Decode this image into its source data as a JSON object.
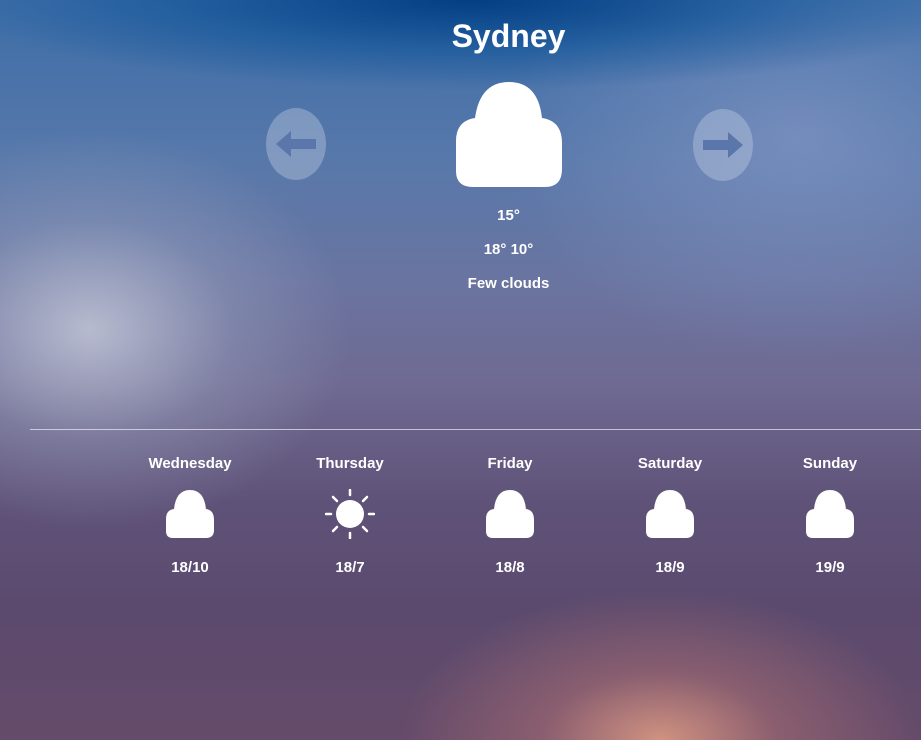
{
  "city": "Sydney",
  "current": {
    "icon": "cloud-icon",
    "temperature": "15°",
    "high_low": "18° 10°",
    "description": "Few clouds"
  },
  "navigation": {
    "prev_icon": "arrow-left-icon",
    "next_icon": "arrow-right-icon"
  },
  "forecast": [
    {
      "day": "Wednesday",
      "icon": "cloud-icon",
      "temps": "18/10"
    },
    {
      "day": "Thursday",
      "icon": "sun-icon",
      "temps": "18/7"
    },
    {
      "day": "Friday",
      "icon": "cloud-icon",
      "temps": "18/8"
    },
    {
      "day": "Saturday",
      "icon": "cloud-icon",
      "temps": "18/9"
    },
    {
      "day": "Sunday",
      "icon": "cloud-icon",
      "temps": "19/9"
    }
  ],
  "colors": {
    "text": "#ffffff",
    "nav_button": "#aeb8d0",
    "nav_arrow": "#5a76aa"
  }
}
